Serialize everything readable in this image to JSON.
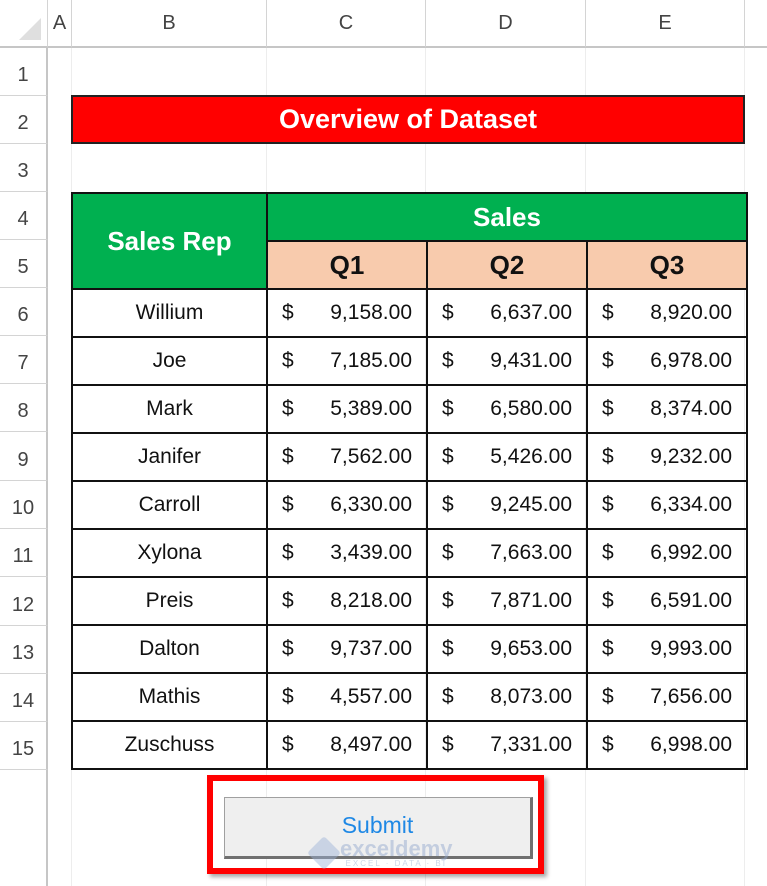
{
  "sheet": {
    "columns": [
      "A",
      "B",
      "C",
      "D",
      "E"
    ],
    "rows": [
      "1",
      "2",
      "3",
      "4",
      "5",
      "6",
      "7",
      "8",
      "9",
      "10",
      "11",
      "12",
      "13",
      "14",
      "15"
    ]
  },
  "title": "Overview of Dataset",
  "table": {
    "header_sales_rep": "Sales Rep",
    "header_sales": "Sales",
    "quarters": [
      "Q1",
      "Q2",
      "Q3"
    ],
    "currency_symbol": "$",
    "rows": [
      {
        "name": "Willium",
        "q1": "9,158.00",
        "q2": "6,637.00",
        "q3": "8,920.00"
      },
      {
        "name": "Joe",
        "q1": "7,185.00",
        "q2": "9,431.00",
        "q3": "6,978.00"
      },
      {
        "name": "Mark",
        "q1": "5,389.00",
        "q2": "6,580.00",
        "q3": "8,374.00"
      },
      {
        "name": "Janifer",
        "q1": "7,562.00",
        "q2": "5,426.00",
        "q3": "9,232.00"
      },
      {
        "name": "Carroll",
        "q1": "6,330.00",
        "q2": "9,245.00",
        "q3": "6,334.00"
      },
      {
        "name": "Xylona",
        "q1": "3,439.00",
        "q2": "7,663.00",
        "q3": "6,992.00"
      },
      {
        "name": "Preis",
        "q1": "8,218.00",
        "q2": "7,871.00",
        "q3": "6,591.00"
      },
      {
        "name": "Dalton",
        "q1": "9,737.00",
        "q2": "9,653.00",
        "q3": "9,993.00"
      },
      {
        "name": "Mathis",
        "q1": "4,557.00",
        "q2": "8,073.00",
        "q3": "7,656.00"
      },
      {
        "name": "Zuschuss",
        "q1": "8,497.00",
        "q2": "7,331.00",
        "q3": "6,998.00"
      }
    ]
  },
  "button": {
    "label": "Submit"
  },
  "watermark": {
    "main": "exceldemy",
    "sub": "EXCEL · DATA · BI"
  },
  "colors": {
    "title_bg": "#ff0000",
    "header_green": "#00b050",
    "quarter_bg": "#f8cbad",
    "highlight_frame": "#ff0000",
    "button_text": "#1e88e5"
  }
}
